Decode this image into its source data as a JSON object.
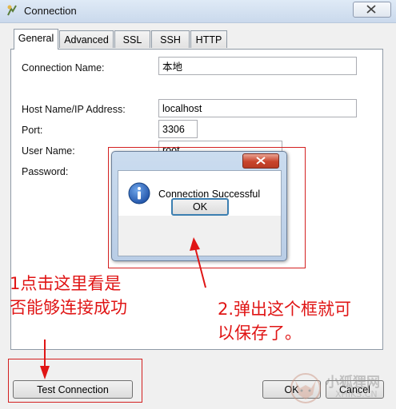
{
  "window": {
    "title": "Connection"
  },
  "tabs": [
    {
      "label": "General",
      "active": true
    },
    {
      "label": "Advanced",
      "active": false
    },
    {
      "label": "SSL",
      "active": false
    },
    {
      "label": "SSH",
      "active": false
    },
    {
      "label": "HTTP",
      "active": false
    }
  ],
  "form": {
    "connection_name_label": "Connection Name:",
    "connection_name_value": "本地",
    "host_label": "Host Name/IP Address:",
    "host_value": "localhost",
    "port_label": "Port:",
    "port_value": "3306",
    "user_label": "User Name:",
    "user_value": "root",
    "password_label": "Password:",
    "password_value": "••••••"
  },
  "dialog": {
    "message": "Connection Successful",
    "ok_label": "OK",
    "icon": "info-icon"
  },
  "buttons": {
    "test_connection": "Test Connection",
    "ok": "OK",
    "cancel": "Cancel"
  },
  "annotations": {
    "note1_line1": "1点击这里看是",
    "note1_line2": "否能够连接成功",
    "note2_line1": "2.弹出这个框就可",
    "note2_line2": "以保存了。",
    "color": "#e01515"
  },
  "watermark": {
    "text": "小狐狸网",
    "sub": "XHIKS.CN"
  },
  "colors": {
    "accent": "#3c7fb1",
    "annotation_red": "#d32020"
  }
}
